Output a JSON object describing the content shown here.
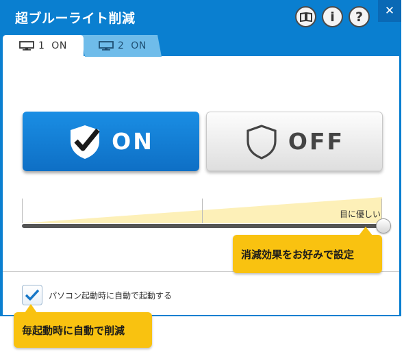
{
  "window": {
    "title": "超ブルーライト削減",
    "close_glyph": "✕"
  },
  "toolbar": {
    "info_glyph": "i",
    "help_glyph": "?"
  },
  "tabs": [
    {
      "label": "1  ON",
      "active": true,
      "icon": "monitor-icon"
    },
    {
      "label": "2  ON",
      "active": false,
      "icon": "monitor-icon"
    }
  ],
  "mode": {
    "on_label": "ON",
    "off_label": "OFF",
    "selected": "ON"
  },
  "strength": {
    "label": "目に優しい",
    "level": 1.0
  },
  "startup": {
    "label": "パソコン起動時に自動で起動する",
    "checked": true
  },
  "callouts": {
    "slider": "消減効果をお好みで設定",
    "startup": "毎起動時に自動で削減"
  },
  "colors": {
    "window_blue": "#0a7fd0",
    "on_button": "#1283d9",
    "callout": "#f9c210",
    "wedge": "#fdf0b8"
  }
}
